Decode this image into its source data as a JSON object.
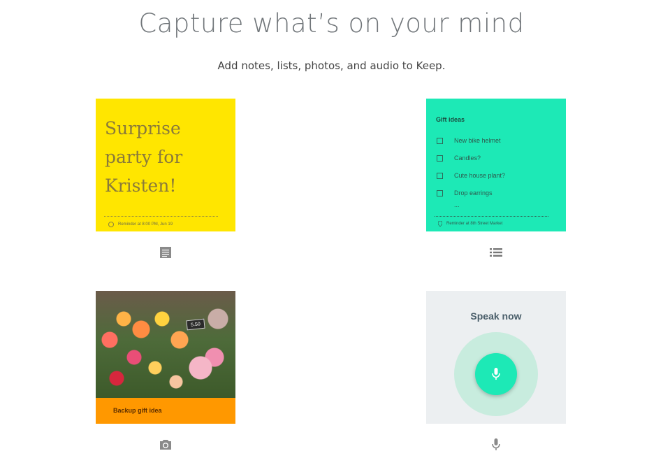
{
  "hero": {
    "title": "Capture what’s on your mind",
    "subtitle": "Add notes, lists, photos, and audio to Keep."
  },
  "cards": {
    "note": {
      "text": "Surprise party for Kristen!",
      "reminder": "Reminder at 8:00 PM, Jun 19",
      "color": "#ffe600",
      "icon": "text-note-icon"
    },
    "list": {
      "title": "Gift ideas",
      "items": [
        "New bike helmet",
        "Candles?",
        "Cute house plant?",
        "Drop earrings"
      ],
      "more": "...",
      "reminder": "Reminder at 8th Street Market",
      "color": "#1de9b6",
      "icon": "list-icon"
    },
    "photo": {
      "caption": "Backup gift idea",
      "price_tag": "5.50",
      "color": "#ff9800",
      "icon": "camera-icon"
    },
    "audio": {
      "prompt": "Speak now",
      "color": "#eceff1",
      "icon": "microphone-icon"
    }
  }
}
